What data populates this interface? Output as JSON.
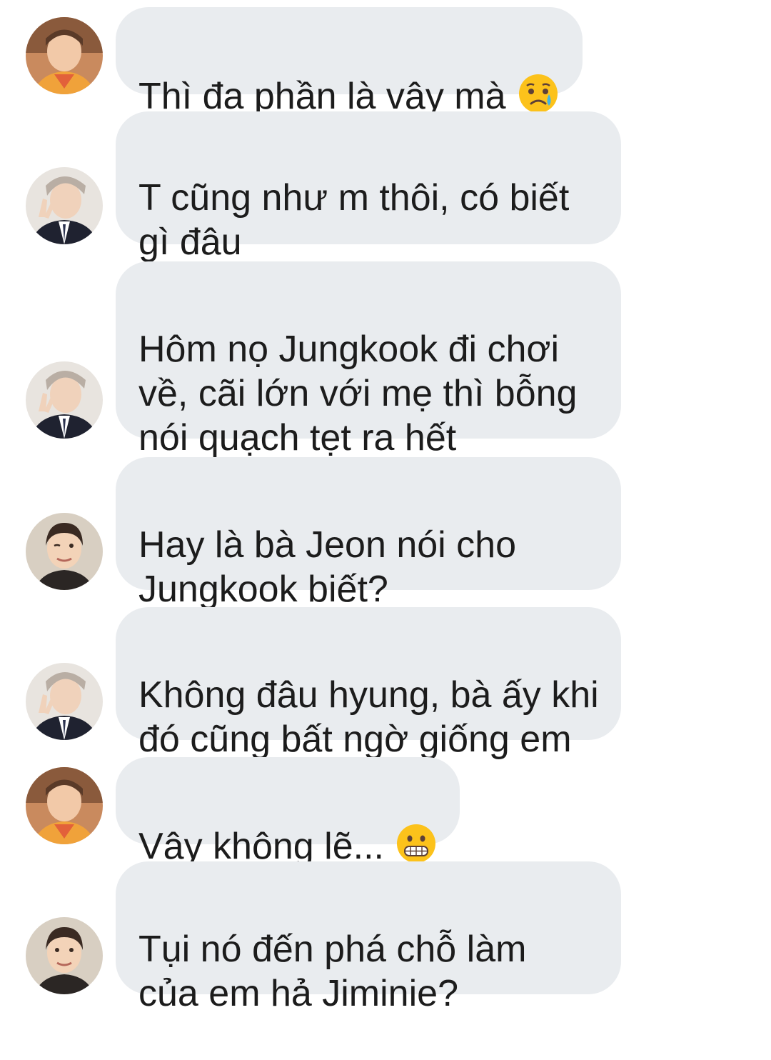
{
  "conversation": {
    "messages": [
      {
        "sender": "avatar-orange-shirt",
        "text": "Thì đa phần là vậy mà",
        "emoji": "crying-face-icon"
      },
      {
        "sender": "avatar-suit-peace",
        "text": "T cũng như m thôi, có biết\ngì đâu"
      },
      {
        "sender": "avatar-suit-peace",
        "text": "Hôm nọ Jungkook đi chơi\nvề, cãi lớn với mẹ thì bỗng\nnói quạch tẹt ra hết"
      },
      {
        "sender": "avatar-wink",
        "text": "Hay là bà Jeon nói cho\nJungkook biết?"
      },
      {
        "sender": "avatar-suit-peace",
        "text": "Không đâu hyung, bà ấy khi\nđó cũng bất ngờ giống em"
      },
      {
        "sender": "avatar-orange-shirt",
        "text": "Vậy không lẽ...",
        "emoji": "grimacing-face-icon"
      },
      {
        "sender": "avatar-wink",
        "text": "Tụi nó đến phá chỗ làm\ncủa em hả Jiminie?"
      }
    ]
  },
  "colors": {
    "bubble": "#e9ecef",
    "text": "#1c1c1c",
    "background": "#ffffff"
  }
}
